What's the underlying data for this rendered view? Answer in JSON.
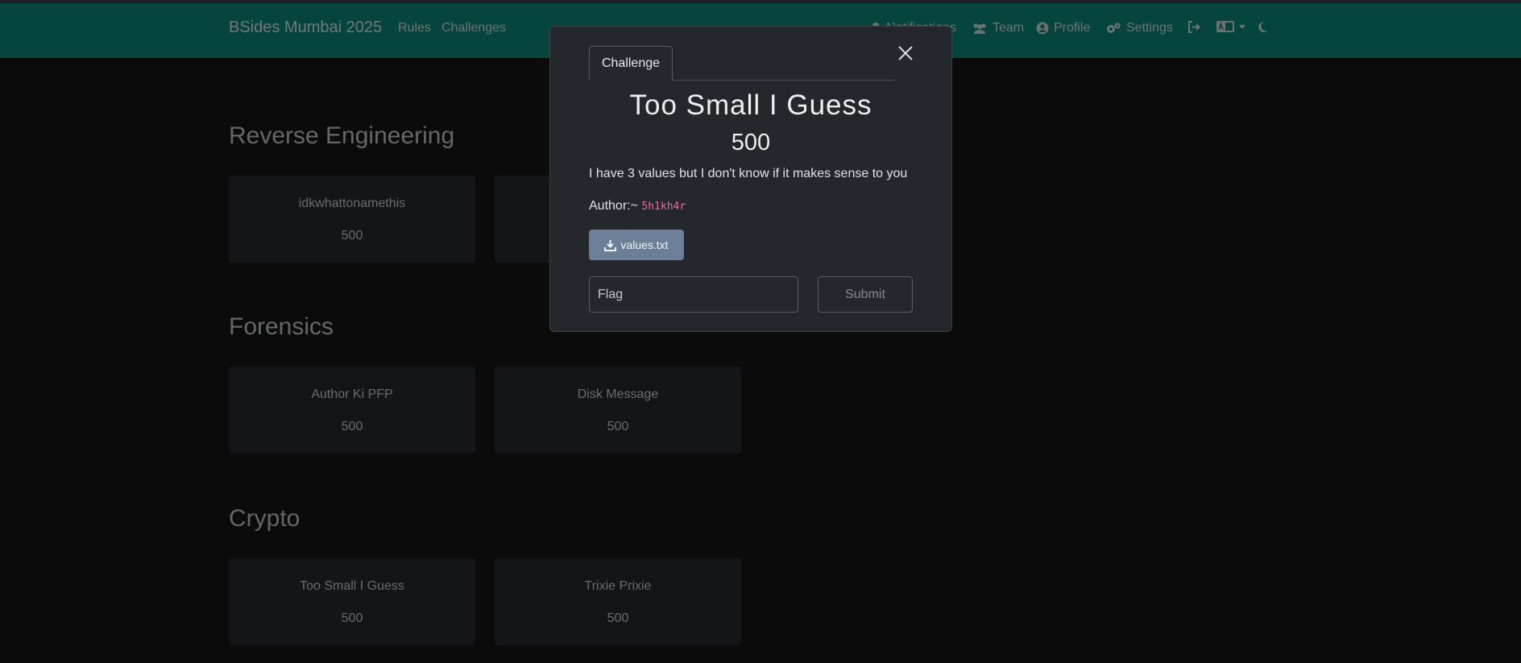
{
  "navbar": {
    "brand": "BSides Mumbai 2025",
    "links": [
      {
        "label": "Rules"
      },
      {
        "label": "Challenges"
      }
    ],
    "right": {
      "notifications": "Notifications",
      "team": "Team",
      "profile": "Profile",
      "settings": "Settings"
    },
    "colors": {
      "background": "#0d8a7d"
    }
  },
  "categories": [
    {
      "title": "Reverse Engineering",
      "challenges": [
        {
          "name": "idkwhattonamethis",
          "value": "500"
        },
        {
          "name": "",
          "value": ""
        }
      ]
    },
    {
      "title": "Forensics",
      "challenges": [
        {
          "name": "Author Ki PFP",
          "value": "500"
        },
        {
          "name": "Disk Message",
          "value": "500"
        }
      ]
    },
    {
      "title": "Crypto",
      "challenges": [
        {
          "name": "Too Small I Guess",
          "value": "500"
        },
        {
          "name": "Trixie Prixie",
          "value": "500"
        }
      ]
    }
  ],
  "modal": {
    "tab_label": "Challenge",
    "title": "Too Small I Guess",
    "value": "500",
    "description": "I have 3 values but I don't know if it makes sense to you",
    "author_prefix": "Author:~",
    "author_handle": "5h1kh4r",
    "file_label": "values.txt",
    "flag_placeholder": "Flag",
    "submit_label": "Submit",
    "icons": {
      "close": "close-icon",
      "download": "download-icon"
    }
  }
}
